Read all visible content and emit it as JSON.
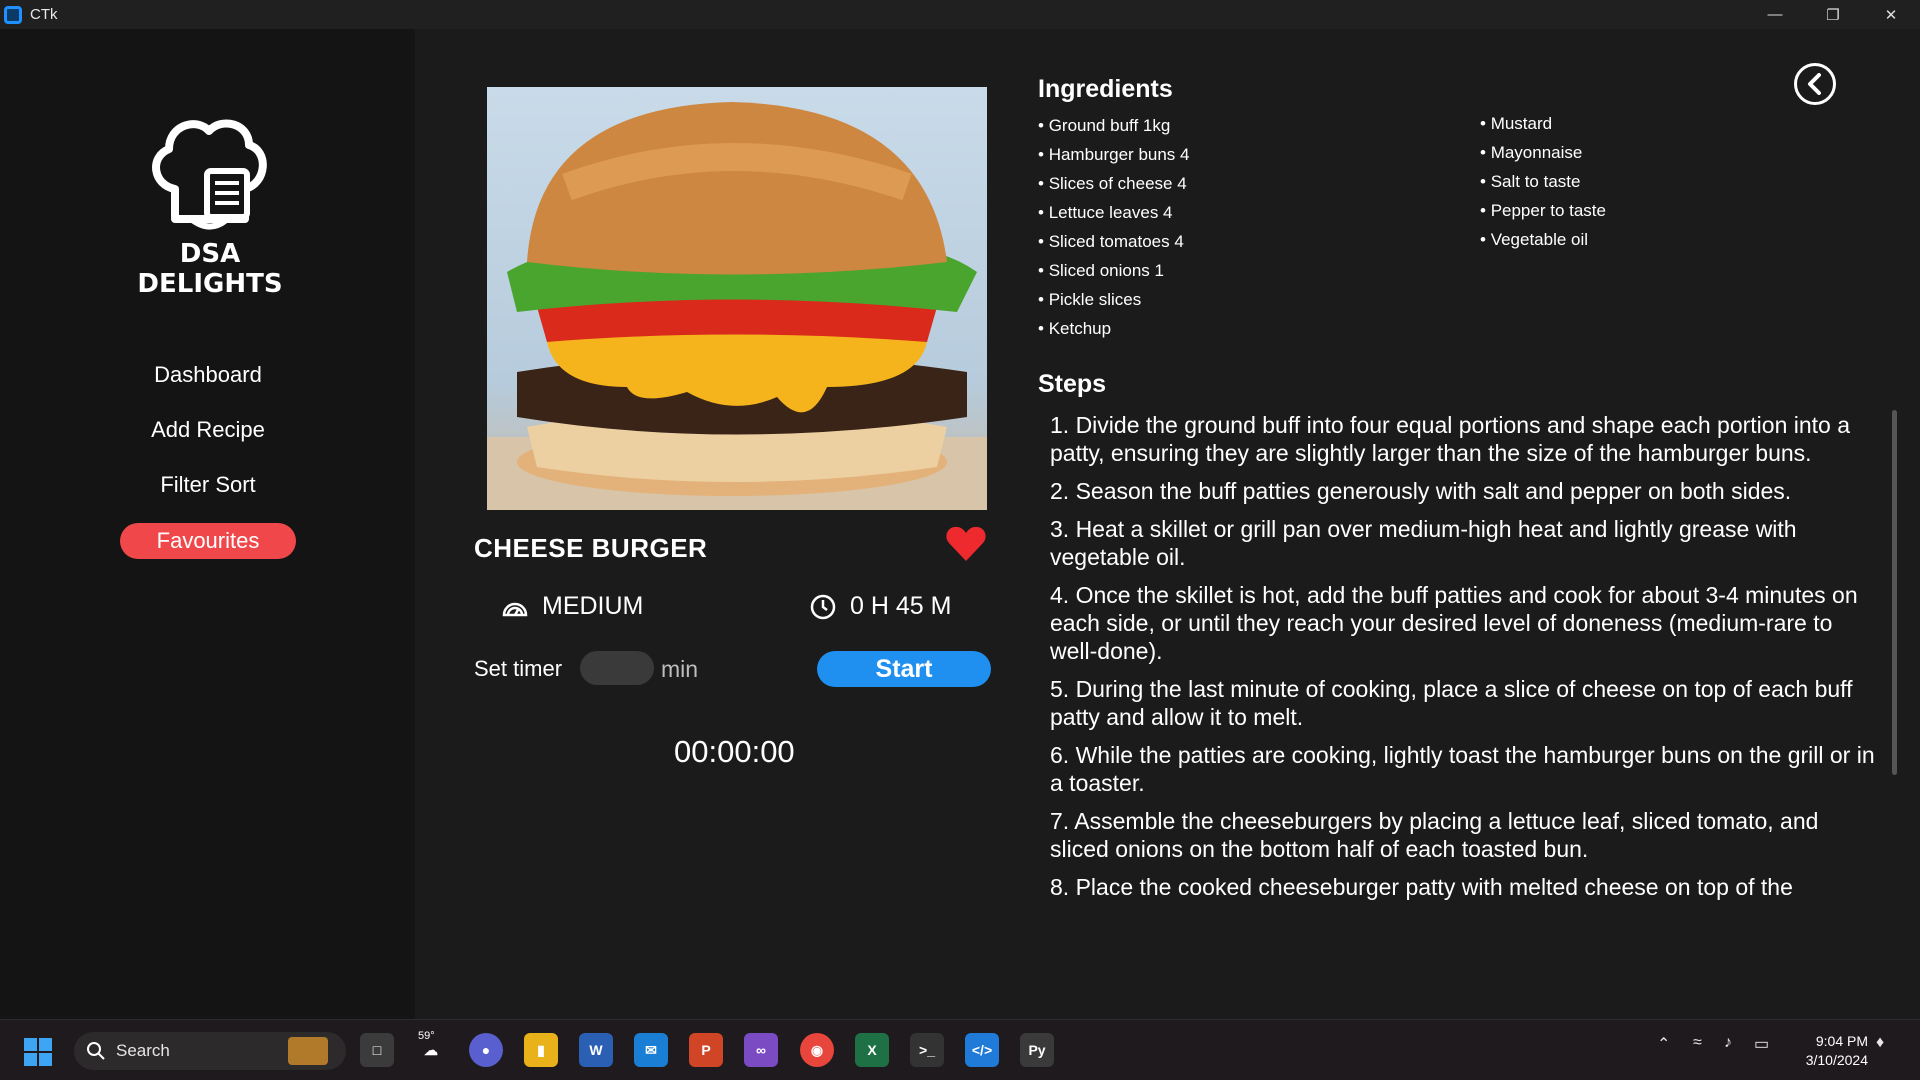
{
  "window": {
    "title": "CTk",
    "controls": [
      "minimize-icon",
      "restore-icon",
      "close-icon"
    ]
  },
  "sidebar": {
    "brand": "DSA DELIGHTS",
    "items": [
      {
        "label": "Dashboard",
        "active": false
      },
      {
        "label": "Add Recipe",
        "active": false
      },
      {
        "label": "Filter Sort",
        "active": false
      },
      {
        "label": "Favourites",
        "active": true
      }
    ],
    "accent": "#f0484a"
  },
  "recipe": {
    "title": "CHEESE BURGER",
    "favourite": true,
    "difficulty": "MEDIUM",
    "duration": "0 H 45 M",
    "timer": {
      "label": "Set timer",
      "value": "",
      "unit": "min",
      "start_label": "Start",
      "display": "00:00:00"
    }
  },
  "ingredients": {
    "heading": "Ingredients",
    "col1": [
      "Ground buff 1kg",
      "Hamburger buns 4",
      "Slices of cheese 4",
      "Lettuce leaves 4",
      "Sliced tomatoes 4",
      "Sliced onions 1",
      "Pickle slices",
      "Ketchup"
    ],
    "col2": [
      "Mustard",
      "Mayonnaise",
      "Salt to taste",
      "Pepper to taste",
      "Vegetable oil"
    ]
  },
  "steps": {
    "heading": "Steps",
    "items": [
      "1. Divide the ground buff into four equal portions and shape each portion into a patty, ensuring they are slightly larger than the size of the hamburger buns.",
      "2. Season the buff patties generously with salt and pepper on both sides.",
      "3. Heat a skillet or grill pan over medium-high heat and lightly grease with vegetable oil.",
      "4. Once the skillet is hot, add the buff patties and cook for about 3-4 minutes on each side, or until they reach your desired level of doneness (medium-rare to well-done).",
      "5. During the last minute of cooking, place a slice of cheese on top of each buff patty and allow it to melt.",
      "6. While the patties are cooking, lightly toast the hamburger buns on the grill or in a toaster.",
      "7. Assemble the cheeseburgers by placing a lettuce leaf, sliced tomato, and sliced onions on the bottom half of each toasted bun.",
      "8. Place the cooked cheeseburger patty with melted cheese on top of the"
    ]
  },
  "taskbar": {
    "search_placeholder": "Search",
    "weather_temp": "59°",
    "time": "9:04 PM",
    "date": "3/10/2024",
    "apps": [
      "task-view",
      "weather",
      "meet",
      "file-explorer",
      "word",
      "mail",
      "powerpoint",
      "visual-studio",
      "chrome",
      "excel",
      "terminal",
      "vscode",
      "python"
    ]
  }
}
